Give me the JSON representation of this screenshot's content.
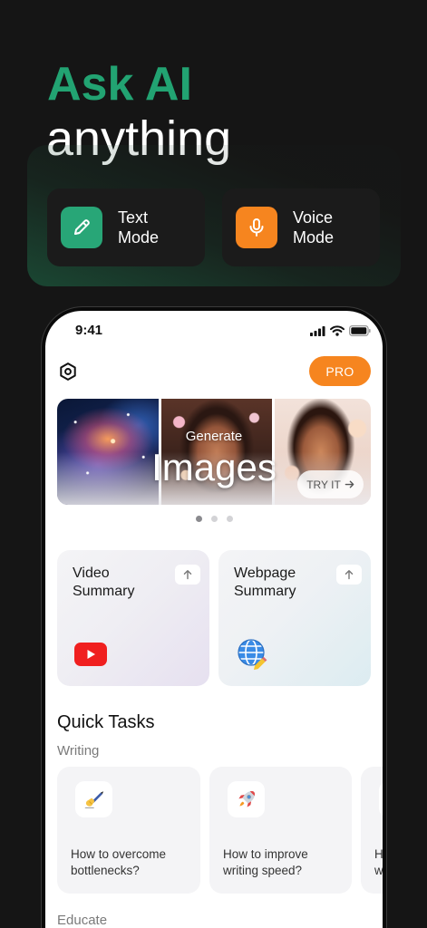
{
  "header": {
    "title_accent": "Ask AI",
    "title_rest": "anything"
  },
  "modes": [
    {
      "label": "Text Mode",
      "icon": "pencil-icon",
      "color": "#28a677"
    },
    {
      "label": "Voice Mode",
      "icon": "microphone-icon",
      "color": "#f6851f"
    }
  ],
  "status_bar": {
    "time": "9:41",
    "icons": [
      "cellular-signal-icon",
      "wifi-icon",
      "battery-icon"
    ]
  },
  "toolbar": {
    "settings_icon": "settings-hexagon-icon",
    "pro_label": "PRO"
  },
  "banner": {
    "subtitle": "Generate",
    "title": "Images",
    "cta_label": "TRY IT",
    "cta_icon": "arrow-right-icon"
  },
  "carousel": {
    "page_count": 3,
    "active_page": 1
  },
  "features": [
    {
      "title": "Video Summary",
      "icon": "youtube-icon",
      "action_icon": "arrow-up-icon"
    },
    {
      "title": "Webpage Summary",
      "icon": "globe-icon",
      "action_icon": "arrow-up-icon"
    }
  ],
  "quick_tasks": {
    "title": "Quick Tasks",
    "sections": [
      {
        "name": "Writing",
        "items": [
          {
            "text": "How to overcome bottlenecks?",
            "icon": "writing-hand-icon"
          },
          {
            "text": "How to improve writing speed?",
            "icon": "rocket-icon"
          },
          {
            "text": "H\nw",
            "icon": ""
          }
        ]
      },
      {
        "name": "Educate",
        "items": []
      }
    ]
  },
  "colors": {
    "background": "#151515",
    "accent_green": "#22a372",
    "accent_orange": "#f6851f",
    "youtube_red": "#f01f1f"
  }
}
